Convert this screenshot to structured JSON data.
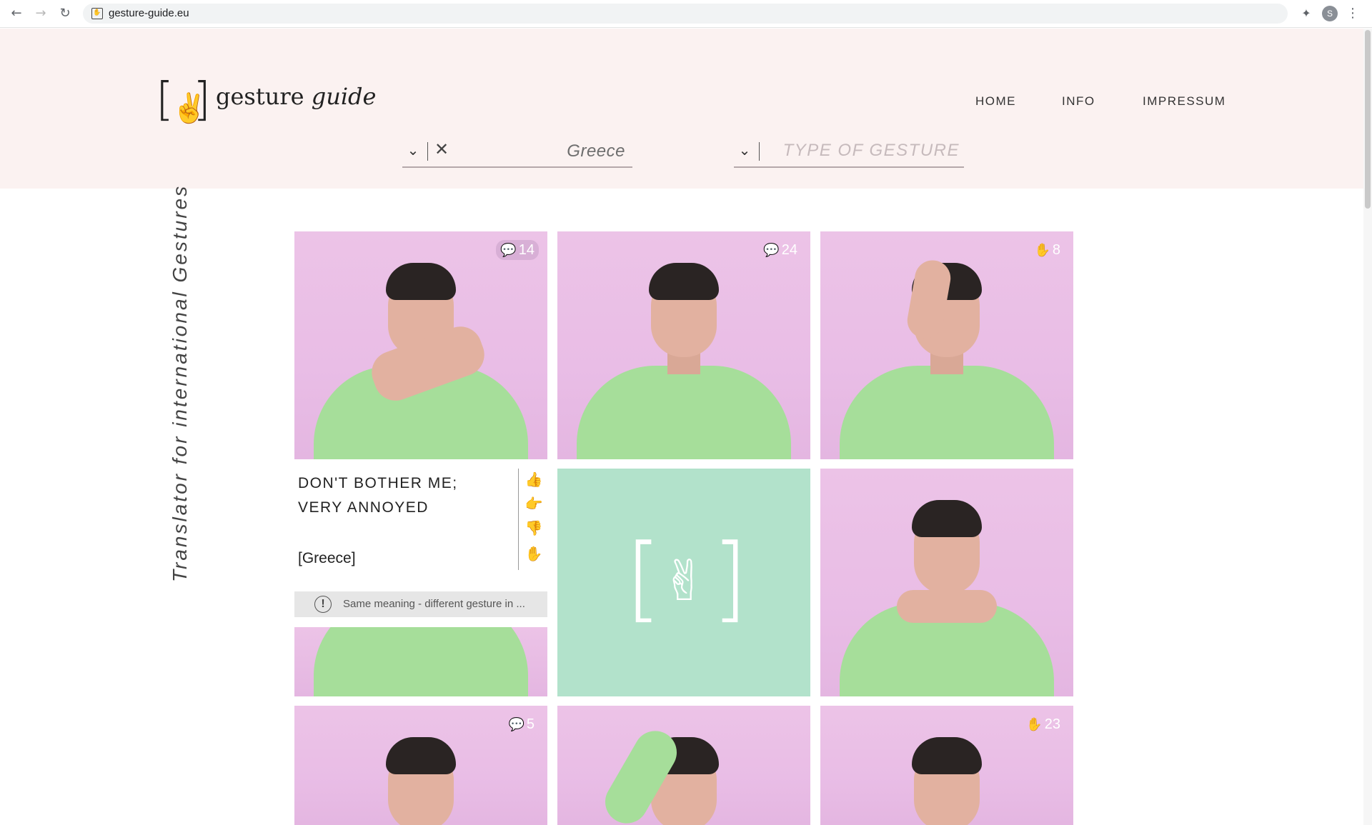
{
  "browser": {
    "url": "gesture-guide.eu",
    "profile_initial": "S"
  },
  "site": {
    "logo_word1": "gesture",
    "logo_word2": "guide",
    "nav": {
      "home": "HOME",
      "info": "INFO",
      "impressum": "IMPRESSUM"
    },
    "tagline": "Translator for international Gestures"
  },
  "filters": {
    "country": {
      "value": "Greece"
    },
    "type": {
      "placeholder": "TYPE OF GESTURE"
    }
  },
  "grid": {
    "badges": {
      "r1c1": "14",
      "r1c2": "24",
      "r1c3": "8",
      "r3c1": "5",
      "r3c3": "23"
    }
  },
  "card": {
    "title_line1": "DON'T BOTHER ME;",
    "title_line2": "VERY ANNOYED",
    "country": "[Greece]",
    "warning": "Same meaning - different gesture in ..."
  },
  "colors": {
    "header_bg": "#fbf2f1",
    "photo_bg": "#e9bde6",
    "sweater": "#a6de9a",
    "logo_tile": "#b2e2cb"
  }
}
